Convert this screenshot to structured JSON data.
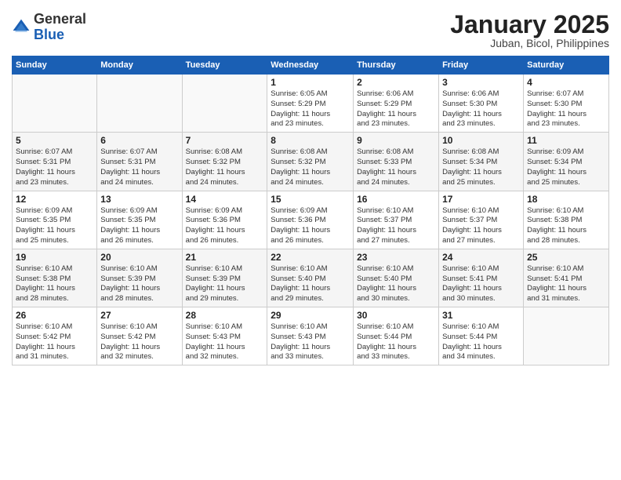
{
  "header": {
    "logo_general": "General",
    "logo_blue": "Blue",
    "month_title": "January 2025",
    "location": "Juban, Bicol, Philippines"
  },
  "days_of_week": [
    "Sunday",
    "Monday",
    "Tuesday",
    "Wednesday",
    "Thursday",
    "Friday",
    "Saturday"
  ],
  "weeks": [
    [
      {
        "day": "",
        "info": ""
      },
      {
        "day": "",
        "info": ""
      },
      {
        "day": "",
        "info": ""
      },
      {
        "day": "1",
        "info": "Sunrise: 6:05 AM\nSunset: 5:29 PM\nDaylight: 11 hours\nand 23 minutes."
      },
      {
        "day": "2",
        "info": "Sunrise: 6:06 AM\nSunset: 5:29 PM\nDaylight: 11 hours\nand 23 minutes."
      },
      {
        "day": "3",
        "info": "Sunrise: 6:06 AM\nSunset: 5:30 PM\nDaylight: 11 hours\nand 23 minutes."
      },
      {
        "day": "4",
        "info": "Sunrise: 6:07 AM\nSunset: 5:30 PM\nDaylight: 11 hours\nand 23 minutes."
      }
    ],
    [
      {
        "day": "5",
        "info": "Sunrise: 6:07 AM\nSunset: 5:31 PM\nDaylight: 11 hours\nand 23 minutes."
      },
      {
        "day": "6",
        "info": "Sunrise: 6:07 AM\nSunset: 5:31 PM\nDaylight: 11 hours\nand 24 minutes."
      },
      {
        "day": "7",
        "info": "Sunrise: 6:08 AM\nSunset: 5:32 PM\nDaylight: 11 hours\nand 24 minutes."
      },
      {
        "day": "8",
        "info": "Sunrise: 6:08 AM\nSunset: 5:32 PM\nDaylight: 11 hours\nand 24 minutes."
      },
      {
        "day": "9",
        "info": "Sunrise: 6:08 AM\nSunset: 5:33 PM\nDaylight: 11 hours\nand 24 minutes."
      },
      {
        "day": "10",
        "info": "Sunrise: 6:08 AM\nSunset: 5:34 PM\nDaylight: 11 hours\nand 25 minutes."
      },
      {
        "day": "11",
        "info": "Sunrise: 6:09 AM\nSunset: 5:34 PM\nDaylight: 11 hours\nand 25 minutes."
      }
    ],
    [
      {
        "day": "12",
        "info": "Sunrise: 6:09 AM\nSunset: 5:35 PM\nDaylight: 11 hours\nand 25 minutes."
      },
      {
        "day": "13",
        "info": "Sunrise: 6:09 AM\nSunset: 5:35 PM\nDaylight: 11 hours\nand 26 minutes."
      },
      {
        "day": "14",
        "info": "Sunrise: 6:09 AM\nSunset: 5:36 PM\nDaylight: 11 hours\nand 26 minutes."
      },
      {
        "day": "15",
        "info": "Sunrise: 6:09 AM\nSunset: 5:36 PM\nDaylight: 11 hours\nand 26 minutes."
      },
      {
        "day": "16",
        "info": "Sunrise: 6:10 AM\nSunset: 5:37 PM\nDaylight: 11 hours\nand 27 minutes."
      },
      {
        "day": "17",
        "info": "Sunrise: 6:10 AM\nSunset: 5:37 PM\nDaylight: 11 hours\nand 27 minutes."
      },
      {
        "day": "18",
        "info": "Sunrise: 6:10 AM\nSunset: 5:38 PM\nDaylight: 11 hours\nand 28 minutes."
      }
    ],
    [
      {
        "day": "19",
        "info": "Sunrise: 6:10 AM\nSunset: 5:38 PM\nDaylight: 11 hours\nand 28 minutes."
      },
      {
        "day": "20",
        "info": "Sunrise: 6:10 AM\nSunset: 5:39 PM\nDaylight: 11 hours\nand 28 minutes."
      },
      {
        "day": "21",
        "info": "Sunrise: 6:10 AM\nSunset: 5:39 PM\nDaylight: 11 hours\nand 29 minutes."
      },
      {
        "day": "22",
        "info": "Sunrise: 6:10 AM\nSunset: 5:40 PM\nDaylight: 11 hours\nand 29 minutes."
      },
      {
        "day": "23",
        "info": "Sunrise: 6:10 AM\nSunset: 5:40 PM\nDaylight: 11 hours\nand 30 minutes."
      },
      {
        "day": "24",
        "info": "Sunrise: 6:10 AM\nSunset: 5:41 PM\nDaylight: 11 hours\nand 30 minutes."
      },
      {
        "day": "25",
        "info": "Sunrise: 6:10 AM\nSunset: 5:41 PM\nDaylight: 11 hours\nand 31 minutes."
      }
    ],
    [
      {
        "day": "26",
        "info": "Sunrise: 6:10 AM\nSunset: 5:42 PM\nDaylight: 11 hours\nand 31 minutes."
      },
      {
        "day": "27",
        "info": "Sunrise: 6:10 AM\nSunset: 5:42 PM\nDaylight: 11 hours\nand 32 minutes."
      },
      {
        "day": "28",
        "info": "Sunrise: 6:10 AM\nSunset: 5:43 PM\nDaylight: 11 hours\nand 32 minutes."
      },
      {
        "day": "29",
        "info": "Sunrise: 6:10 AM\nSunset: 5:43 PM\nDaylight: 11 hours\nand 33 minutes."
      },
      {
        "day": "30",
        "info": "Sunrise: 6:10 AM\nSunset: 5:44 PM\nDaylight: 11 hours\nand 33 minutes."
      },
      {
        "day": "31",
        "info": "Sunrise: 6:10 AM\nSunset: 5:44 PM\nDaylight: 11 hours\nand 34 minutes."
      },
      {
        "day": "",
        "info": ""
      }
    ]
  ]
}
